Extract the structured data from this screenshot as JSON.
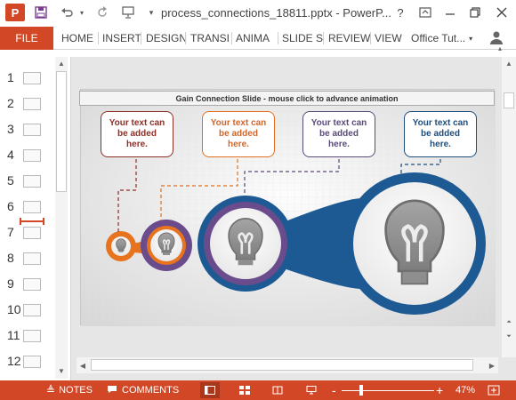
{
  "app": {
    "logo_letter": "P",
    "document_title": "process_connections_18811.pptx - PowerP...",
    "help_label": "?",
    "accent_color": "#d24726"
  },
  "ribbon": {
    "file_label": "FILE",
    "tabs": [
      "HOME",
      "INSERT",
      "DESIGN",
      "TRANSI",
      "ANIMA",
      "SLIDE S",
      "REVIEW",
      "VIEW"
    ],
    "user_label": "Office Tut..."
  },
  "thumbnails": {
    "numbers": [
      "1",
      "2",
      "3",
      "4",
      "5",
      "6",
      "7",
      "8",
      "9",
      "10",
      "11",
      "12"
    ]
  },
  "slide": {
    "title": "Gain Connection Slide - mouse click to advance animation",
    "callouts": [
      {
        "line1": "Your text can",
        "line2": "be added",
        "line3": "here.",
        "color": "#8b2f26"
      },
      {
        "line1": "Your text can",
        "line2": "be added",
        "line3": "here.",
        "color": "#e07020"
      },
      {
        "line1": "Your text can",
        "line2": "be added",
        "line3": "here.",
        "color": "#5a4a7a"
      },
      {
        "line1": "Your text can",
        "line2": "be added",
        "line3": "here.",
        "color": "#1e4e7a"
      }
    ],
    "colors": {
      "orange": "#e8731e",
      "purple": "#6a4c8c",
      "blue": "#1d5a94",
      "bulb_gray": "#8e8e8e"
    }
  },
  "statusbar": {
    "notes_label": "NOTES",
    "comments_label": "COMMENTS",
    "zoom_minus": "-",
    "zoom_plus": "+",
    "zoom_level": "47%"
  }
}
